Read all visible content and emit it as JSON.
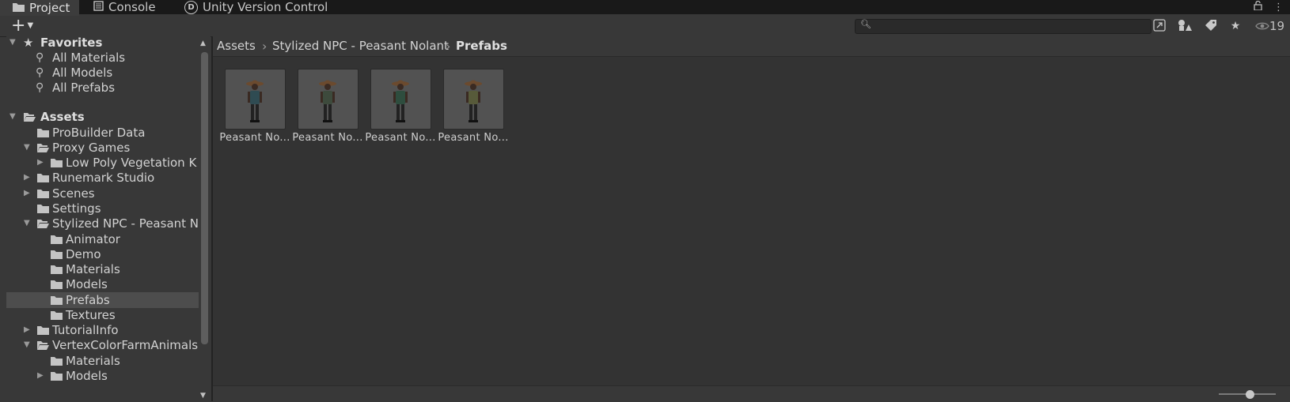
{
  "tabs": [
    {
      "label": "Project",
      "icon": "folder-icon"
    },
    {
      "label": "Console",
      "icon": "console-icon"
    },
    {
      "label": "Unity Version Control",
      "icon": "version-control-icon"
    }
  ],
  "toolbar": {
    "create_icon": "plus-icon",
    "search_placeholder": "",
    "search_value": "",
    "hidden_packages_count": "19"
  },
  "tree": {
    "favorites": {
      "label": "Favorites",
      "items": [
        "All Materials",
        "All Models",
        "All Prefabs"
      ]
    },
    "assets": {
      "label": "Assets",
      "items": [
        {
          "label": "ProBuilder Data"
        },
        {
          "label": "Proxy Games"
        },
        {
          "label": "Low Poly Vegetation K"
        },
        {
          "label": "Runemark Studio"
        },
        {
          "label": "Scenes"
        },
        {
          "label": "Settings"
        },
        {
          "label": "Stylized NPC - Peasant N"
        },
        {
          "label": "Animator"
        },
        {
          "label": "Demo"
        },
        {
          "label": "Materials"
        },
        {
          "label": "Models"
        },
        {
          "label": "Prefabs"
        },
        {
          "label": "Textures"
        },
        {
          "label": "TutorialInfo"
        },
        {
          "label": "VertexColorFarmAnimals"
        },
        {
          "label": "Materials"
        },
        {
          "label": "Models"
        }
      ]
    }
  },
  "breadcrumb": [
    "Assets",
    "Stylized NPC - Peasant Nolant",
    "Prefabs"
  ],
  "assets_grid": [
    {
      "name": "Peasant No...",
      "shirt": "#2f4b52"
    },
    {
      "name": "Peasant No...",
      "shirt": "#3d4a3c"
    },
    {
      "name": "Peasant No...",
      "shirt": "#2e4d3e"
    },
    {
      "name": "Peasant No...",
      "shirt": "#575a3a"
    }
  ],
  "zoom_slider": {
    "fraction": 0.55
  }
}
